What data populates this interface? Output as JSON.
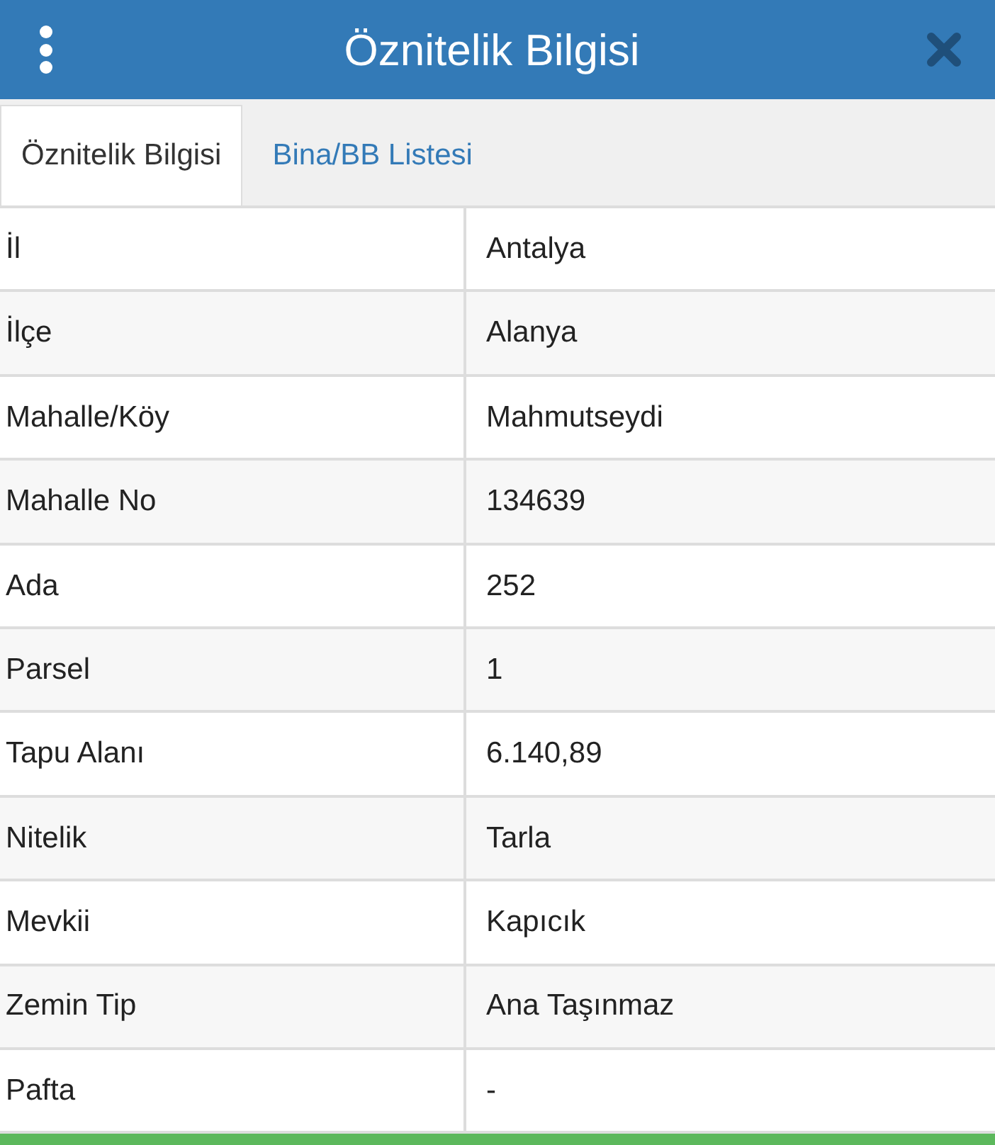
{
  "header": {
    "title": "Öznitelik Bilgisi"
  },
  "tabs": [
    {
      "label": "Öznitelik Bilgisi",
      "selected": true
    },
    {
      "label": "Bina/BB Listesi",
      "selected": false
    }
  ],
  "table": {
    "rows": [
      {
        "label": "İl",
        "value": "Antalya"
      },
      {
        "label": "İlçe",
        "value": "Alanya"
      },
      {
        "label": "Mahalle/Köy",
        "value": "Mahmutseydi"
      },
      {
        "label": "Mahalle No",
        "value": "134639"
      },
      {
        "label": "Ada",
        "value": "252"
      },
      {
        "label": "Parsel",
        "value": "1"
      },
      {
        "label": "Tapu Alanı",
        "value": "6.140,89"
      },
      {
        "label": "Nitelik",
        "value": "Tarla"
      },
      {
        "label": "Mevkii",
        "value": "Kapıcık"
      },
      {
        "label": "Zemin Tip",
        "value": "Ana Taşınmaz"
      },
      {
        "label": "Pafta",
        "value": "-"
      }
    ]
  }
}
